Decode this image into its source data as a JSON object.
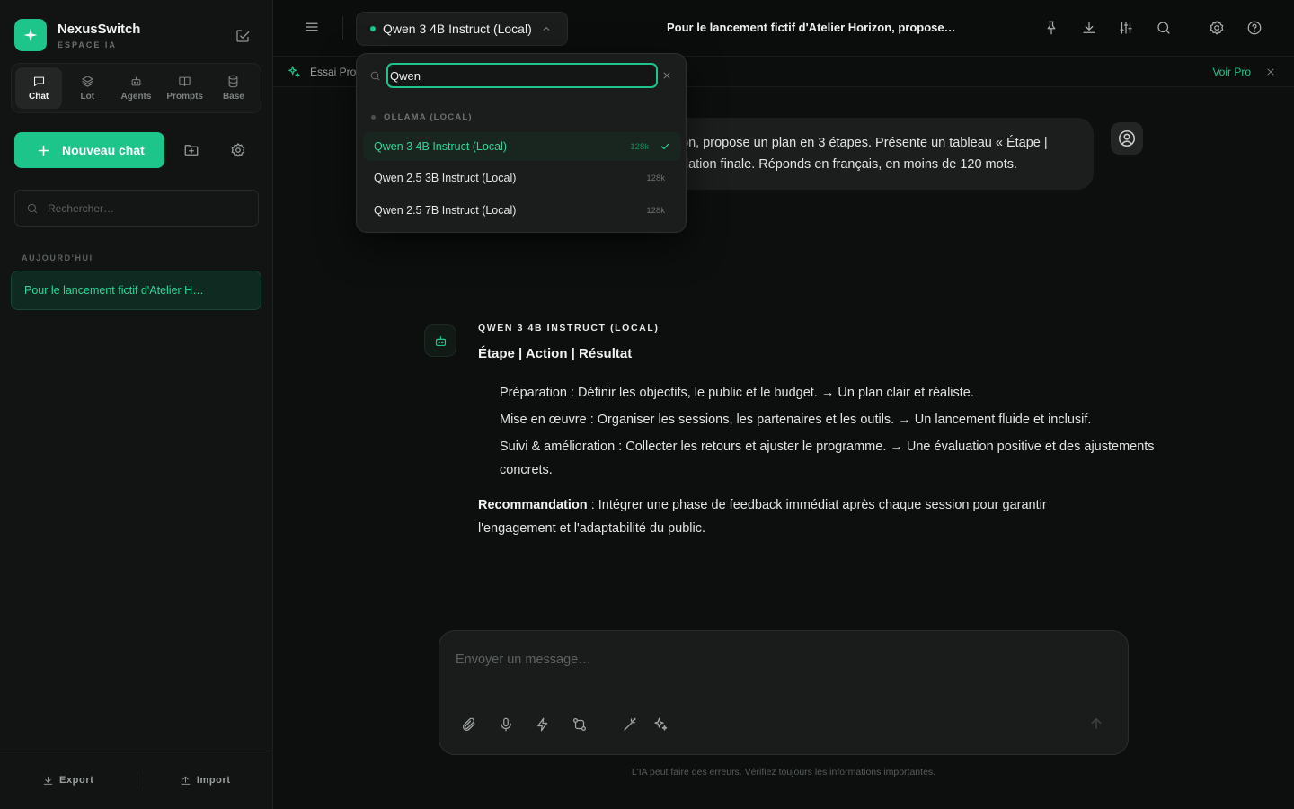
{
  "brand": {
    "name": "NexusSwitch",
    "subtitle": "ESPACE IA"
  },
  "nav_tabs": [
    {
      "label": "Chat",
      "icon": "chat-bubble-icon",
      "active": true
    },
    {
      "label": "Lot",
      "icon": "layers-icon",
      "active": false
    },
    {
      "label": "Agents",
      "icon": "bot-icon",
      "active": false
    },
    {
      "label": "Prompts",
      "icon": "book-icon",
      "active": false
    },
    {
      "label": "Base",
      "icon": "database-icon",
      "active": false
    }
  ],
  "sidebar": {
    "new_chat_label": "Nouveau chat",
    "search_placeholder": "Rechercher…",
    "section_today": "AUJOURD'HUI",
    "history": [
      "Pour le lancement fictif d'Atelier H…"
    ],
    "export_label": "Export",
    "import_label": "Import"
  },
  "topbar": {
    "model_label": "Qwen 3 4B Instruct (Local)",
    "chat_title": "Pour le lancement fictif d'Atelier Horizon, propose…",
    "actions": [
      "pin-icon",
      "download-icon",
      "sliders-icon",
      "search-icon",
      "settings-icon",
      "help-icon"
    ]
  },
  "promo": {
    "text": "Essai Pro",
    "link": "Voir Pro"
  },
  "dropdown": {
    "search_value": "Qwen",
    "group_label": "OLLAMA (LOCAL)",
    "items": [
      {
        "label": "Qwen 3 4B Instruct (Local)",
        "context": "128k",
        "selected": true
      },
      {
        "label": "Qwen 2.5 3B Instruct (Local)",
        "context": "128k",
        "selected": false
      },
      {
        "label": "Qwen 2.5 7B Instruct (Local)",
        "context": "128k",
        "selected": false
      }
    ]
  },
  "user_message": "on, propose un plan en 3 étapes. Présente un tableau « Étape | …dation finale. Réponds en français, en moins de 120 mots.",
  "user_message_lines": [
    "on, propose un plan en 3 étapes. Présente un tableau « Étape |",
    "dation finale. Réponds en français, en moins de 120 mots."
  ],
  "assistant": {
    "name": "QWEN 3 4B INSTRUCT (LOCAL)",
    "heading": "Étape | Action | Résultat",
    "steps": [
      "Préparation : Définir les objectifs, le public et le budget. → Un plan clair et réaliste.",
      "Mise en œuvre : Organiser les sessions, les partenaires et les outils. → Un lancement fluide et inclusif.",
      "Suivi & amélioration : Collecter les retours et ajuster le programme. → Une évaluation positive et des ajustements concrets."
    ],
    "reco_label": "Recommandation",
    "reco_text": " : Intégrer une phase de feedback immédiat après chaque session pour garantir l'engagement et l'adaptabilité du public."
  },
  "composer": {
    "placeholder": "Envoyer un message…",
    "tools": [
      "paperclip-icon",
      "microphone-icon",
      "bolt-icon",
      "git-compare-icon",
      "magic-wand-icon",
      "sparkles-icon"
    ]
  },
  "disclaimer": "L'IA peut faire des erreurs. Vérifiez toujours les informations importantes.",
  "colors": {
    "accent": "#1ec58a",
    "background": "#0d0e0e",
    "sidebar": "#121413",
    "panel": "#1b1d1c"
  }
}
